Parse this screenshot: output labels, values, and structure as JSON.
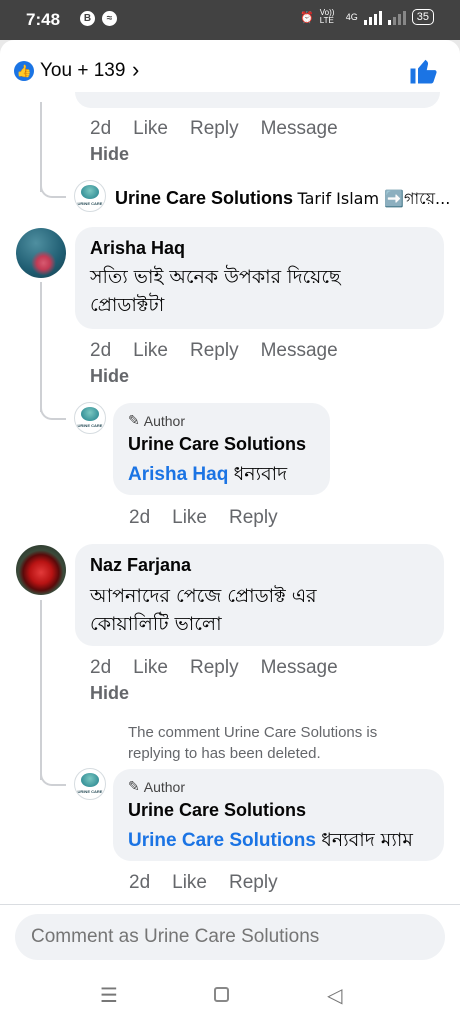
{
  "status": {
    "time": "7:48",
    "battery": "35",
    "volte": "Vo)) LTE",
    "network": "4G"
  },
  "header": {
    "reactions": "You + 139"
  },
  "thread": {
    "reply1": {
      "actions": [
        "2d",
        "Like",
        "Reply",
        "Message"
      ],
      "hide": "Hide",
      "collapsed_name": "Urine Care Solutions",
      "collapsed_text": "Tarif Islam ➡️গায়ে..."
    },
    "comment2": {
      "name": "Arisha Haq",
      "text_line1": "সত্যি ভাই অনেক উপকার দিয়েছে",
      "text_line2": "প্রোডাক্টটা",
      "actions": [
        "2d",
        "Like",
        "Reply",
        "Message"
      ],
      "hide": "Hide"
    },
    "reply2": {
      "tag": "Author",
      "name": "Urine Care Solutions",
      "mention": "Arisha Haq",
      "text": "ধন্যবাদ",
      "actions": [
        "2d",
        "Like",
        "Reply"
      ]
    },
    "comment3": {
      "name": "Naz Farjana",
      "text_line1": "আপনাদের পেজে প্রোডাক্ট এর",
      "text_line2": "কোয়ালিটি ভালো",
      "actions": [
        "2d",
        "Like",
        "Reply",
        "Message"
      ],
      "hide": "Hide"
    },
    "deleted_note_line1": "The comment Urine Care Solutions is",
    "deleted_note_line2": "replying to has been deleted.",
    "reply3": {
      "tag": "Author",
      "name": "Urine Care Solutions",
      "mention": "Urine Care Solutions",
      "text": "ধন্যবাদ ম্যাম",
      "actions": [
        "2d",
        "Like",
        "Reply"
      ]
    },
    "logo_text": "URINE CARE"
  },
  "composer": {
    "placeholder": "Comment as Urine Care Solutions"
  },
  "colors": {
    "accent": "#1b74e4",
    "bubble": "#f0f2f5",
    "muted": "#65676b"
  }
}
